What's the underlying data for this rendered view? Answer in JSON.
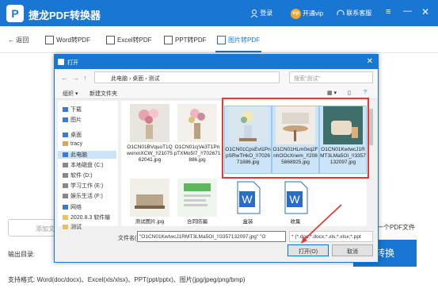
{
  "app": {
    "title": "捷龙PDF转换器",
    "login": "登录",
    "vip_badge": "vip",
    "vip": "开通vip",
    "support": "联系客服",
    "brand_color": "#1976d2"
  },
  "toolbar": {
    "back": "返回",
    "tabs": [
      {
        "label": "Word转PDF"
      },
      {
        "label": "Excel转PDF"
      },
      {
        "label": "PPT转PDF"
      },
      {
        "label": "图片转PDF",
        "active": true
      }
    ]
  },
  "main": {
    "add_file": "添加文",
    "output_label": "输出目录:",
    "right_label": "一个PDF文件",
    "convert": "转换",
    "formats": "支持格式:    Word(doc/docx)、Excel(xls/xlsx)、PPT(ppt/pptx)、图片(jpg/jpeg/png/bmp)"
  },
  "dialog": {
    "title": "打开",
    "path": [
      "此电脑",
      "桌面",
      "测试"
    ],
    "search_placeholder": "搜索\"测试\"",
    "organize": "组织 ▾",
    "new_folder": "新建文件夹",
    "sidebar": [
      {
        "label": "下载",
        "color": "#3a7bd5"
      },
      {
        "label": "图片",
        "color": "#3a7bd5"
      },
      {
        "label": "桌面",
        "color": "#3a7bd5"
      },
      {
        "label": "tracy",
        "color": "#d8a656"
      },
      {
        "label": "此电脑",
        "color": "#3a7bd5",
        "selected": true
      },
      {
        "label": "本地磁盘 (C:)",
        "color": "#888888"
      },
      {
        "label": "软件 (D:)",
        "color": "#888888"
      },
      {
        "label": "学习工作 (E:)",
        "color": "#888888"
      },
      {
        "label": "娱乐生活 (F:)",
        "color": "#888888"
      },
      {
        "label": "网络",
        "color": "#3a7bd5"
      },
      {
        "label": "2020.8.3 软件输",
        "color": "#e6c35c"
      },
      {
        "label": "测试",
        "color": "#e6c35c"
      }
    ],
    "files": [
      {
        "name": "O1CN01BVquoT1QworxnXCW_!!2107562041.jpg",
        "kind": "flowers",
        "selected": false
      },
      {
        "name": "O1CN01cjVe3T1PnpTXMo5I7_!!702671886.jpg",
        "kind": "flowers2",
        "selected": false
      },
      {
        "name": "O1CN01CpsEvl1PnpSRwTHkO_!!702671886.jpg",
        "kind": "vase",
        "selected": true
      },
      {
        "name": "O1CN01HLm0xq2FnhOOcXnem_!!2085868925.jpg",
        "kind": "table",
        "selected": true
      },
      {
        "name": "O1CN01KwIwcJ1RMT3LMa5OI_!!3357132097.jpg",
        "kind": "chair",
        "selected": true
      },
      {
        "name": "测试图片.jpg",
        "kind": "room",
        "selected": false
      },
      {
        "name": "合同防骗",
        "kind": "doc",
        "selected": false
      },
      {
        "name": "盒装",
        "kind": "word",
        "selected": false
      },
      {
        "name": "收集",
        "kind": "word",
        "selected": false
      }
    ],
    "filename_label": "文件名(N):",
    "filename_value": "\"O1CN01KwIwcJ1RMT3LMa5OI_!!3357132097.jpg\" \"O",
    "filetype_value": "* (*.doc;*.docx;*.xls;*.xlsx;*.ppt",
    "open_button": "打开(O)",
    "cancel_button": "取消"
  }
}
